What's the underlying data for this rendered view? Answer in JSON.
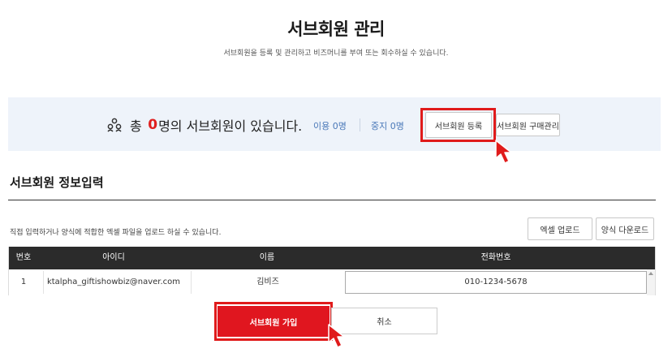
{
  "page": {
    "title": "서브회원 관리",
    "subtitle": "서브회원을 등록 및 관리하고 비즈머니를 부여 또는 회수하실 수 있습니다."
  },
  "summary": {
    "prefix": "총",
    "count": "0",
    "suffix": "명의 서브회원이 있습니다.",
    "active_label": "이용 0명",
    "suspended_label": "중지 0명",
    "register_button": "서브회원 등록",
    "purchase_button": "서브회원 구매관리",
    "icon": "people-icon"
  },
  "section": {
    "title": "서브회원 정보입력",
    "helper": "직접 입력하거나 양식에 적합한 엑셀 파일을 업로드 하실 수 있습니다.",
    "excel_upload_button": "엑셀 업로드",
    "template_download_button": "양식 다운로드"
  },
  "table": {
    "columns": [
      "번호",
      "아이디",
      "이름",
      "전화번호"
    ],
    "rows": [
      {
        "no": "1",
        "id": "ktalpha_giftishowbiz@naver.com",
        "name": "김비즈",
        "phone": "010-1234-5678"
      }
    ]
  },
  "actions": {
    "submit_button": "서브회원 가입",
    "cancel_button": "취소"
  },
  "colors": {
    "accent": "#e0161f",
    "highlight": "#e01b1b",
    "panel_bg": "#eef3fa",
    "header_bg": "#2b2b2b",
    "stat_text": "#4a78b8"
  }
}
